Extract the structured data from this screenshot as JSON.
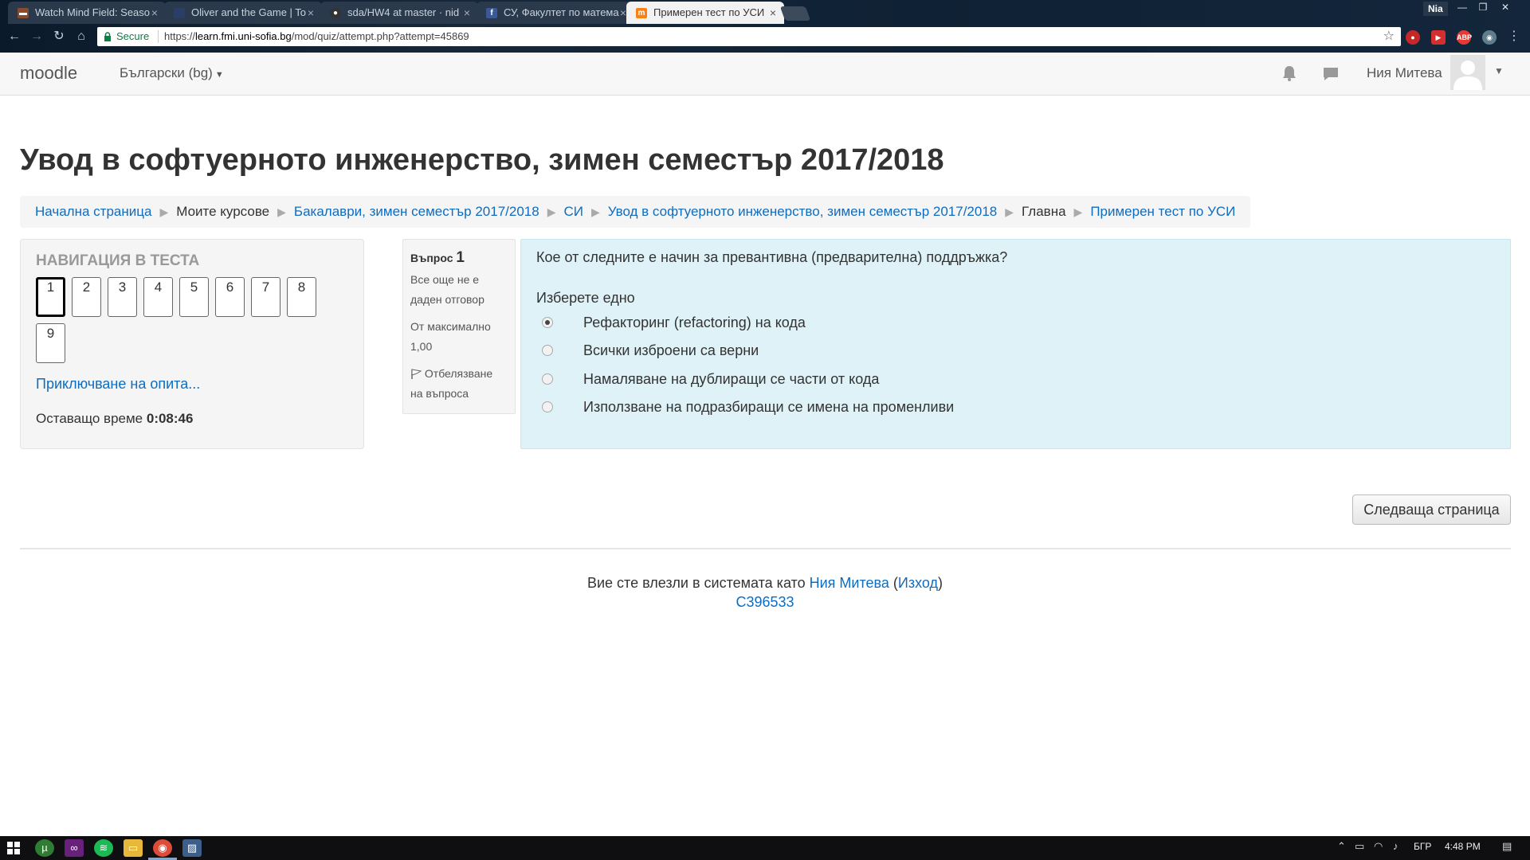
{
  "browser": {
    "tabs": [
      {
        "title": "Watch Mind Field: Seaso",
        "favicon": "film-icon",
        "favicon_color": "#8a4b2a",
        "active": false
      },
      {
        "title": "Oliver and the Game | To",
        "favicon": "page-icon",
        "favicon_color": "#2c3e66",
        "active": false
      },
      {
        "title": "sda/HW4 at master · nid",
        "favicon": "github-icon",
        "favicon_color": "#333333",
        "active": false
      },
      {
        "title": "СУ, Факултет по матема",
        "favicon": "facebook-icon",
        "favicon_color": "#3b5998",
        "active": false
      },
      {
        "title": "Примерен тест по УСИ",
        "favicon": "moodle-icon",
        "favicon_color": "#f98012",
        "active": true
      }
    ],
    "profile_name": "Nia",
    "secure_label": "Secure",
    "url_scheme": "https://",
    "url_host": "learn.fmi.uni-sofia.bg",
    "url_path": "/mod/quiz/attempt.php?attempt=45869"
  },
  "navbar": {
    "brand": "moodle",
    "language": "Български (bg)",
    "user_name": "Ния Митева"
  },
  "page": {
    "title": "Увод в софтуерното инженерство, зимен семестър 2017/2018"
  },
  "breadcrumb": [
    {
      "label": "Начална страница",
      "link": true
    },
    {
      "label": "Моите курсове",
      "link": false
    },
    {
      "label": "Бакалаври, зимен семестър 2017/2018",
      "link": true
    },
    {
      "label": "СИ",
      "link": true
    },
    {
      "label": "Увод в софтуерното инженерство, зимен семестър 2017/2018",
      "link": true
    },
    {
      "label": "Главна",
      "link": false
    },
    {
      "label": "Примерен тест по УСИ",
      "link": true
    }
  ],
  "quiz_nav": {
    "title": "НАВИГАЦИЯ В ТЕСТА",
    "questions": [
      "1",
      "2",
      "3",
      "4",
      "5",
      "6",
      "7",
      "8",
      "9"
    ],
    "current": "1",
    "finish_link": "Приключване на опита...",
    "time_label": "Оставащо време",
    "time_value": "0:08:46"
  },
  "question": {
    "label": "Въпрос",
    "number": "1",
    "status": "Все още не е даден отговор",
    "marks": "От максимално 1,00",
    "flag_label": "Отбелязване на въпроса",
    "text": "Кое от следните е начин за превантивна (предварителна) поддръжка?",
    "prompt": "Изберете едно",
    "options": [
      {
        "label": "Рефакторинг (refactoring) на кода",
        "selected": true
      },
      {
        "label": "Всички изброени са верни",
        "selected": false
      },
      {
        "label": "Намаляване на дублиращи се части от кода",
        "selected": false
      },
      {
        "label": "Използване на подразбиращи се имена на променливи",
        "selected": false
      }
    ]
  },
  "actions": {
    "next_page": "Следваща страница"
  },
  "footer": {
    "logged_in_prefix": "Вие сте влезли в системата като",
    "user_link": "Ния Митева",
    "logout_open": "(",
    "logout_link": "Изход",
    "logout_close": ")",
    "course_code": "C396533"
  },
  "taskbar": {
    "language": "БГР",
    "time": "4:48 PM"
  },
  "colors": {
    "link": "#0f6cbf",
    "question_bg": "#def2f8",
    "block_bg": "#f5f5f5"
  }
}
